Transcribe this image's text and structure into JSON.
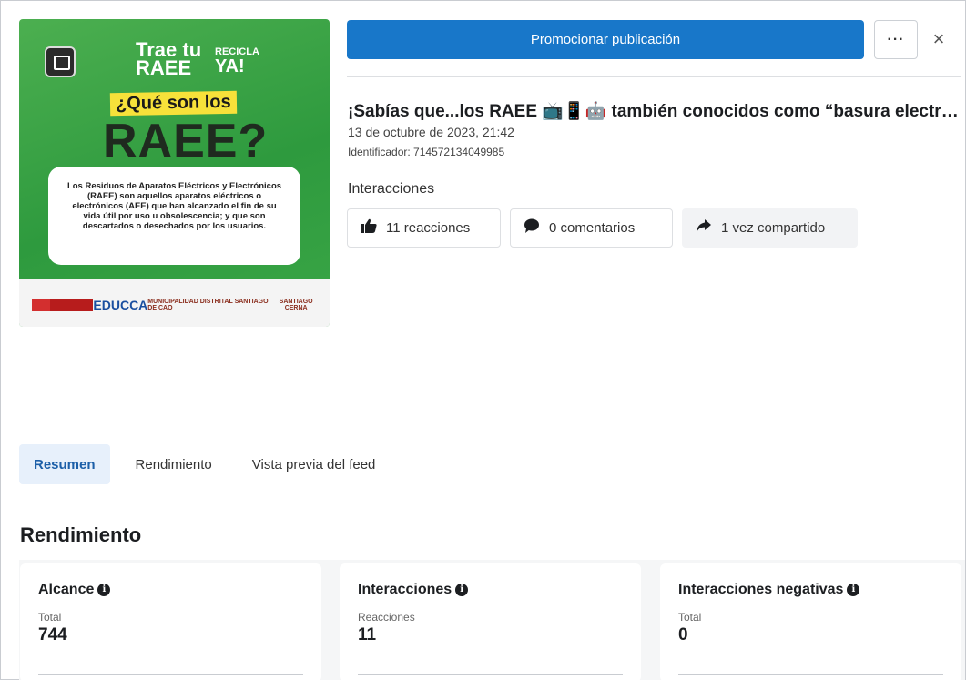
{
  "post_image": {
    "campaign_line1": "Trae tu",
    "campaign_line2": "RAEE",
    "recicla_small": "RECICLA",
    "recicla_big": "YA!",
    "question": "¿Qué son los",
    "headline": "RAEE?",
    "description": "Los Residuos de Aparatos Eléctricos y Electrónicos (RAEE) son aquellos aparatos eléctricos o electrónicos (AEE) que han alcanzado el fin de su vida útil por uso u obsolescencia; y que son descartados o desechados por los usuarios.",
    "logo_educca": "EDUCCA",
    "logo_muni": "MUNICIPALIDAD DISTRITAL SANTIAGO DE CAO",
    "logo_santiago": "SANTIAGO CERNA"
  },
  "header": {
    "promote_label": "Promocionar publicación",
    "more_label": "···",
    "close_label": "×"
  },
  "post": {
    "title": "¡Sabías que...los RAEE 📺📱🤖 también conocidos como “basura electrónica”",
    "date": "13 de octubre de 2023, 21:42",
    "identifier": "Identificador: 714572134049985"
  },
  "interactions": {
    "label": "Interacciones",
    "reactions": "11 reacciones",
    "comments": "0 comentarios",
    "shares": "1 vez compartido"
  },
  "tabs": [
    {
      "label": "Resumen",
      "active": true
    },
    {
      "label": "Rendimiento",
      "active": false
    },
    {
      "label": "Vista previa del feed",
      "active": false
    }
  ],
  "section_title": "Rendimiento",
  "metrics": [
    {
      "title": "Alcance",
      "sublabel": "Total",
      "value": "744"
    },
    {
      "title": "Interacciones",
      "sublabel": "Reacciones",
      "value": "11"
    },
    {
      "title": "Interacciones negativas",
      "sublabel": "Total",
      "value": "0"
    }
  ],
  "colors": {
    "primary_button": "#1877c9",
    "active_tab_bg": "#e7f0fb",
    "image_green": "#3aa646"
  }
}
